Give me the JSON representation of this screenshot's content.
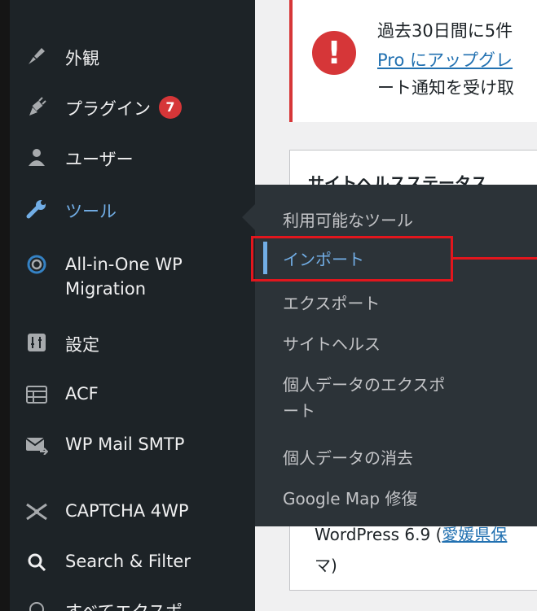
{
  "sidebar": {
    "items": [
      {
        "label": "外観",
        "icon": "paintbrush-icon"
      },
      {
        "label": "プラグイン",
        "icon": "plugin-icon",
        "badge": "7"
      },
      {
        "label": "ユーザー",
        "icon": "user-icon"
      },
      {
        "label": "ツール",
        "icon": "wrench-icon",
        "active": true
      },
      {
        "label_line1": "All-in-One WP",
        "label_line2": "Migration",
        "icon": "migration-icon"
      },
      {
        "label": "設定",
        "icon": "settings-icon"
      },
      {
        "label": "ACF",
        "icon": "acf-icon"
      },
      {
        "label": "WP Mail SMTP",
        "icon": "mail-icon"
      },
      {
        "label": "CAPTCHA 4WP",
        "icon": "captcha-icon"
      },
      {
        "label": "Search & Filter",
        "icon": "search-icon"
      },
      {
        "label": "すべてエクスポ",
        "icon": "export-all-icon"
      }
    ]
  },
  "flyout": {
    "items": [
      {
        "label": "利用可能なツール"
      },
      {
        "label": "インポート",
        "current": true
      },
      {
        "label": "エクスポート"
      },
      {
        "label": "サイトヘルス"
      },
      {
        "label_line1": "個人データのエクスポ",
        "label_line2": "ート"
      },
      {
        "label": "個人データの消去"
      },
      {
        "label": "Google Map 修復"
      }
    ]
  },
  "notice": {
    "line1": "過去30日間に5件",
    "link": "Pro にアップグレ",
    "line3": "ート通知を受け取"
  },
  "panel": {
    "title": "サイトヘルスステータス",
    "footer_prefix": "WordPress 6.9 (",
    "footer_link": "愛媛県保",
    "footer_line2": "マ)"
  },
  "colors": {
    "sidebar_bg": "#1d2327",
    "flyout_bg": "#2c3338",
    "active": "#72aee6",
    "badge": "#d63638",
    "highlight": "#e2161d"
  }
}
